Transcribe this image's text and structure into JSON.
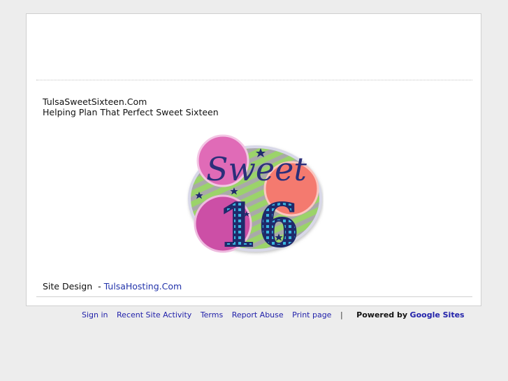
{
  "page": {
    "site_title": "TulsaSweetSixteen.Com",
    "tagline": "Helping Plan That Perfect Sweet Sixteen",
    "logo": {
      "line1": "Sweet",
      "line2": "16",
      "icon": "sweet-16-logo"
    },
    "credit_label": "Site Design  - ",
    "credit_link": "TulsaHosting.Com"
  },
  "footer": {
    "links": [
      "Sign in",
      "Recent Site Activity",
      "Terms",
      "Report Abuse",
      "Print page"
    ],
    "separator": "|",
    "powered_by": "Powered by",
    "brand": "Google Sites"
  },
  "colors": {
    "background": "#ededed",
    "link": "#2233aa",
    "logo_pink": "#e06bb7",
    "logo_salmon": "#f47a6f",
    "logo_magenta": "#cc4fa6",
    "logo_green": "#9bd36b",
    "logo_navy": "#1f2a6b"
  }
}
